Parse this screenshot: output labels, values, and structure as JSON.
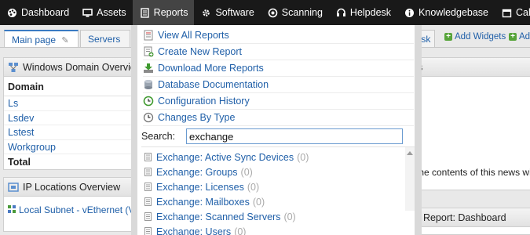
{
  "nav": {
    "items": [
      {
        "name": "nav-dashboard",
        "icon": "palette-icon",
        "label": "Dashboard"
      },
      {
        "name": "nav-assets",
        "icon": "monitor-icon",
        "label": "Assets"
      },
      {
        "name": "nav-reports",
        "icon": "document-icon",
        "label": "Reports",
        "active": true
      },
      {
        "name": "nav-software",
        "icon": "gear-cloud-icon",
        "label": "Software"
      },
      {
        "name": "nav-scanning",
        "icon": "radar-icon",
        "label": "Scanning"
      },
      {
        "name": "nav-helpdesk",
        "icon": "headset-icon",
        "label": "Helpdesk"
      },
      {
        "name": "nav-knowledgebase",
        "icon": "info-icon",
        "label": "Knowledgebase"
      },
      {
        "name": "nav-calendar",
        "icon": "calendar-icon",
        "label": "Caler"
      }
    ]
  },
  "tabs": {
    "main_label": "Main page",
    "servers_label": "Servers",
    "right_label": "lesk"
  },
  "widget_actions": {
    "add_widgets": "Add Widgets",
    "add_other": "Ad"
  },
  "domain_widget": {
    "title": "Windows Domain Overview",
    "column": "Domain",
    "rows": [
      "Ls",
      "Lsdev",
      "Lstest",
      "Workgroup"
    ],
    "total": "Total"
  },
  "ip_widget": {
    "title": "IP Locations Overview",
    "row": "Local Subnet - vEthernet (Vir"
  },
  "news_widget": {
    "title_fragment": "s",
    "text": "The contents of this news wi"
  },
  "report_widget": {
    "title": "t Report: Dashboard"
  },
  "reports_menu": {
    "items": [
      {
        "name": "menu-view-all-reports",
        "icon": "report-list-icon",
        "label": "View All Reports"
      },
      {
        "name": "menu-create-new-report",
        "icon": "new-report-icon",
        "label": "Create New Report"
      },
      {
        "name": "menu-download-more-reports",
        "icon": "download-icon",
        "label": "Download More Reports"
      },
      {
        "name": "menu-database-documentation",
        "icon": "database-icon",
        "label": "Database Documentation"
      },
      {
        "name": "menu-configuration-history",
        "icon": "history-icon",
        "label": "Configuration History"
      },
      {
        "name": "menu-changes-by-type",
        "icon": "clock-icon",
        "label": "Changes By Type"
      }
    ],
    "search_label": "Search:",
    "search_value": "exchange",
    "results": [
      {
        "label": "Exchange: Active Sync Devices",
        "count": "(0)"
      },
      {
        "label": "Exchange: Groups",
        "count": "(0)"
      },
      {
        "label": "Exchange: Licenses",
        "count": "(0)"
      },
      {
        "label": "Exchange: Mailboxes",
        "count": "(0)"
      },
      {
        "label": "Exchange: Scanned Servers",
        "count": "(0)"
      },
      {
        "label": "Exchange: Users",
        "count": "(0)"
      }
    ]
  },
  "colors": {
    "nav_bg": "#191919",
    "link": "#1f5fa8",
    "active_tab_border": "#3a7bc3",
    "search_border": "#6a9bd0",
    "count_grey": "#aaaaaa"
  }
}
